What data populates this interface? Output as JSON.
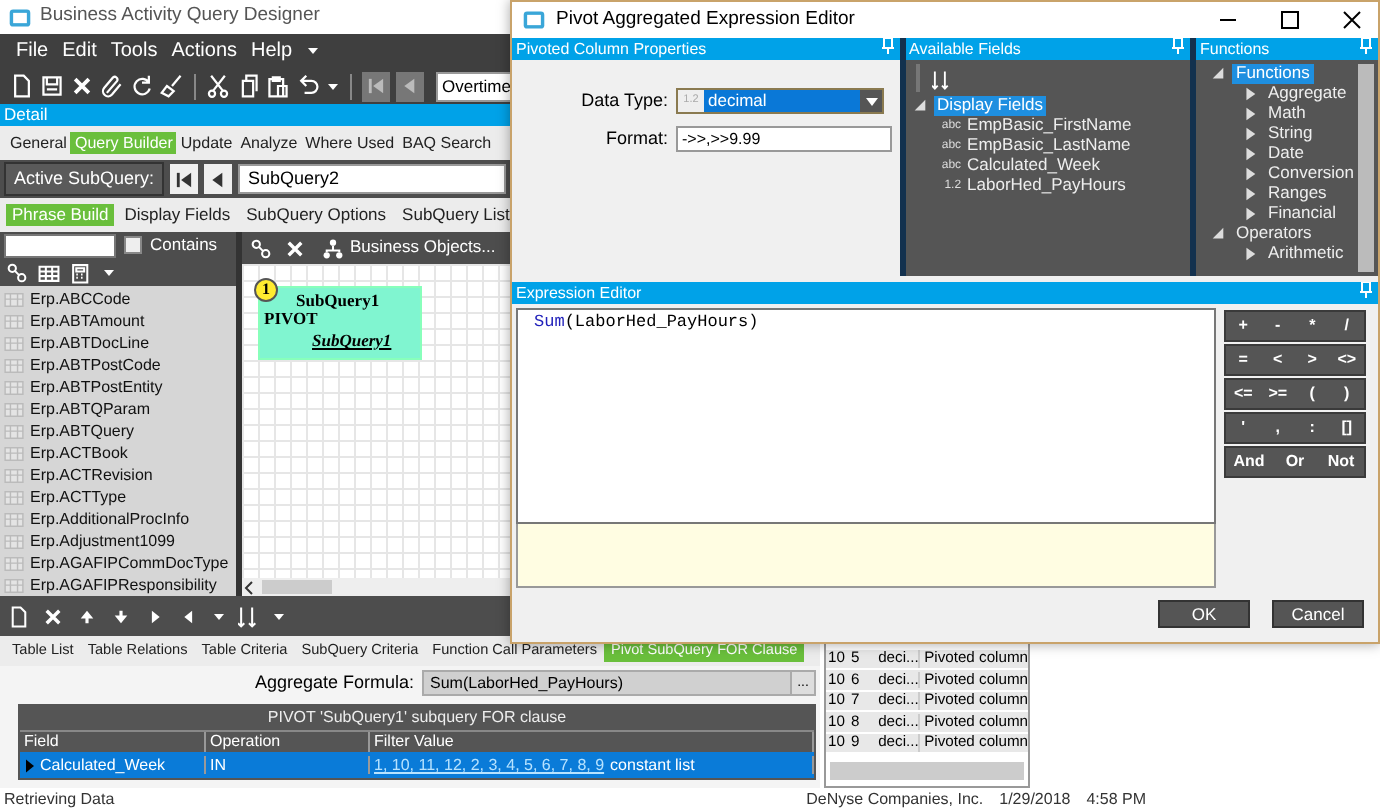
{
  "main_window": {
    "title": "Business Activity Query Designer",
    "menu": [
      "File",
      "Edit",
      "Tools",
      "Actions",
      "Help"
    ],
    "toolbar_field": "Overtime",
    "detail_header": "Detail",
    "tabs": [
      {
        "label": "General",
        "selected": false
      },
      {
        "label": "Query Builder",
        "selected": true
      },
      {
        "label": "Update",
        "selected": false
      },
      {
        "label": "Analyze",
        "selected": false
      },
      {
        "label": "Where Used",
        "selected": false
      },
      {
        "label": "BAQ Search",
        "selected": false
      }
    ],
    "active_subquery": {
      "label": "Active SubQuery:",
      "value": "SubQuery2"
    },
    "subtabs": [
      {
        "label": "Phrase Build",
        "selected": true
      },
      {
        "label": "Display Fields",
        "selected": false
      },
      {
        "label": "SubQuery Options",
        "selected": false
      },
      {
        "label": "SubQuery List",
        "selected": false
      }
    ],
    "table_search": {
      "contains_label": "Contains",
      "contains_checked": false
    },
    "tables": [
      "Erp.ABCCode",
      "Erp.ABTAmount",
      "Erp.ABTDocLine",
      "Erp.ABTPostCode",
      "Erp.ABTPostEntity",
      "Erp.ABTQParam",
      "Erp.ABTQuery",
      "Erp.ACTBook",
      "Erp.ACTRevision",
      "Erp.ACTType",
      "Erp.AdditionalProcInfo",
      "Erp.Adjustment1099",
      "Erp.AGAFIPCommDocType",
      "Erp.AGAFIPResponsibility"
    ],
    "canvas": {
      "toolbar_button": "Business Objects...",
      "node": {
        "number": "1",
        "title": "SubQuery1",
        "type": "PIVOT",
        "link": "SubQuery1"
      }
    },
    "bottom_tabs": [
      {
        "label": "Table List",
        "selected": false
      },
      {
        "label": "Table Relations",
        "selected": false
      },
      {
        "label": "Table Criteria",
        "selected": false
      },
      {
        "label": "SubQuery Criteria",
        "selected": false
      },
      {
        "label": "Function Call Parameters",
        "selected": false
      },
      {
        "label": "Pivot SubQuery FOR Clause",
        "selected": true
      }
    ],
    "aggregate_formula": {
      "label": "Aggregate Formula:",
      "value": "Sum(LaborHed_PayHours)",
      "button": "..."
    },
    "for_clause": {
      "title": "PIVOT 'SubQuery1' subquery FOR clause",
      "columns": [
        "Field",
        "Operation",
        "Filter Value"
      ],
      "rows": [
        {
          "field": "Calculated_Week",
          "operation": "IN",
          "values": "1, 10, 11, 12, 2, 3, 4, 5, 6, 7, 8, 9",
          "suffix": "constant list",
          "selected": true
        }
      ]
    },
    "columns_grid": {
      "rows": [
        {
          "column_1": "10",
          "column_2": "5",
          "column_3": "deci...",
          "column_4": "Pivoted column"
        },
        {
          "column_1": "10",
          "column_2": "6",
          "column_3": "deci...",
          "column_4": "Pivoted column"
        },
        {
          "column_1": "10",
          "column_2": "7",
          "column_3": "deci...",
          "column_4": "Pivoted column"
        },
        {
          "column_1": "10",
          "column_2": "8",
          "column_3": "deci...",
          "column_4": "Pivoted column"
        },
        {
          "column_1": "10",
          "column_2": "9",
          "column_3": "deci...",
          "column_4": "Pivoted column"
        }
      ]
    },
    "status_bar": {
      "message": "Retrieving Data",
      "company": "DeNyse Companies, Inc.",
      "date": "1/29/2018",
      "time": "4:58 PM"
    }
  },
  "dialog": {
    "title": "Pivot Aggregated Expression Editor",
    "properties_panel": {
      "title": "Pivoted Column Properties",
      "data_type_label": "Data Type:",
      "data_type_icon": "1.2",
      "data_type_value": "decimal",
      "format_label": "Format:",
      "format_value": "->>,>>9.99"
    },
    "fields_panel": {
      "title": "Available Fields",
      "tree": [
        {
          "label": "Display Fields",
          "expanded": true,
          "selected": true,
          "children": [
            {
              "type_tag": "abc",
              "label": "EmpBasic_FirstName"
            },
            {
              "type_tag": "abc",
              "label": "EmpBasic_LastName"
            },
            {
              "type_tag": "abc",
              "label": "Calculated_Week"
            },
            {
              "type_tag": "1.2",
              "label": "LaborHed_PayHours"
            }
          ]
        }
      ]
    },
    "functions_panel": {
      "title": "Functions",
      "tree": [
        {
          "label": "Functions",
          "expanded": true,
          "selected": true,
          "children": [
            {
              "label": "Aggregate",
              "expanded": false,
              "selected": false
            },
            {
              "label": "Math",
              "expanded": false,
              "selected": false
            },
            {
              "label": "String",
              "expanded": false,
              "selected": false
            },
            {
              "label": "Date",
              "expanded": false,
              "selected": false
            },
            {
              "label": "Conversion",
              "expanded": false,
              "selected": false
            },
            {
              "label": "Ranges",
              "expanded": false,
              "selected": false
            },
            {
              "label": "Financial",
              "expanded": false,
              "selected": false
            }
          ]
        },
        {
          "label": "Operators",
          "expanded": true,
          "selected": false,
          "children": [
            {
              "label": "Arithmetic",
              "expanded": false,
              "selected": false
            }
          ]
        }
      ]
    },
    "expression_panel": {
      "title": "Expression Editor",
      "keyword": "Sum",
      "expression": "(LaborHed_PayHours)",
      "operators": [
        [
          "+",
          "-",
          "*",
          "/"
        ],
        [
          "=",
          "<",
          ">",
          "<>"
        ],
        [
          "<=",
          ">=",
          "(",
          ")"
        ],
        [
          "'",
          ",",
          ":",
          "[]"
        ],
        [
          "And",
          "Or",
          "Not"
        ]
      ]
    },
    "buttons": [
      "OK",
      "Cancel"
    ]
  }
}
